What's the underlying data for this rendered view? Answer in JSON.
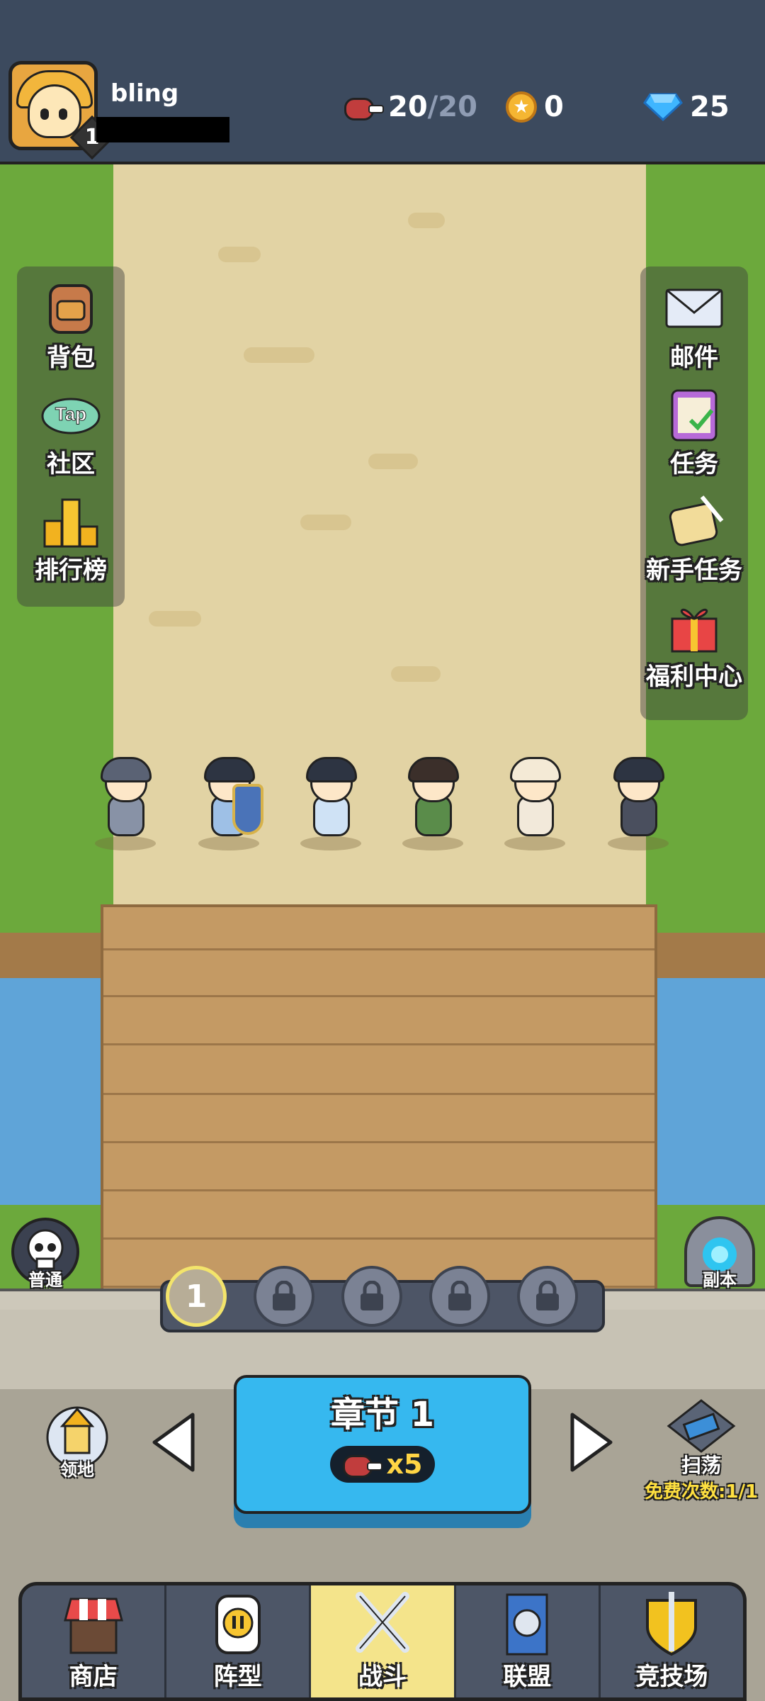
{
  "player": {
    "name": "bling",
    "level": "1"
  },
  "resources": {
    "stamina_current": "20",
    "stamina_sep": "/",
    "stamina_max": "20",
    "coins": "0",
    "gems": "25"
  },
  "left_menu": [
    {
      "label": "背包",
      "icon": "backpack-icon"
    },
    {
      "label": "社区",
      "icon": "tap-community-icon",
      "badge": "Tap"
    },
    {
      "label": "排行榜",
      "icon": "leaderboard-icon"
    }
  ],
  "right_menu": [
    {
      "label": "邮件",
      "icon": "mail-icon"
    },
    {
      "label": "任务",
      "icon": "quest-icon"
    },
    {
      "label": "新手任务",
      "icon": "newbie-quest-icon"
    },
    {
      "label": "福利中心",
      "icon": "gift-icon"
    }
  ],
  "heroes": [
    {
      "name": "hammer-knight",
      "color": "#8892a6"
    },
    {
      "name": "shield-guard",
      "color": "#9ec0e6"
    },
    {
      "name": "cleric",
      "color": "#cfe2f5"
    },
    {
      "name": "beast-warrior",
      "color": "#5a8c4a"
    },
    {
      "name": "druid",
      "color": "#f2e9da"
    },
    {
      "name": "swordsman",
      "color": "#4a4f5e"
    }
  ],
  "difficulty": {
    "label": "普通"
  },
  "dungeon": {
    "label": "副本"
  },
  "stages": [
    {
      "label": "1",
      "locked": false
    },
    {
      "label": "",
      "locked": true
    },
    {
      "label": "",
      "locked": true
    },
    {
      "label": "",
      "locked": true
    },
    {
      "label": "",
      "locked": true
    }
  ],
  "chapter": {
    "title": "章节 1",
    "cost": "x5"
  },
  "territory": {
    "label": "领地"
  },
  "sweep": {
    "label": "扫荡",
    "free_text": "免费次数:1/1"
  },
  "nav": [
    {
      "label": "商店",
      "icon": "shop-icon",
      "active": false
    },
    {
      "label": "阵型",
      "icon": "formation-icon",
      "active": false
    },
    {
      "label": "战斗",
      "icon": "battle-swords-icon",
      "active": true
    },
    {
      "label": "联盟",
      "icon": "alliance-banner-icon",
      "active": false
    },
    {
      "label": "竞技场",
      "icon": "arena-shield-icon",
      "active": false
    }
  ],
  "colors": {
    "topbar": "#3c4a5e",
    "chapter_button": "#36b8ef",
    "active_tab": "#f4e48b",
    "free_text": "#ffe040"
  }
}
